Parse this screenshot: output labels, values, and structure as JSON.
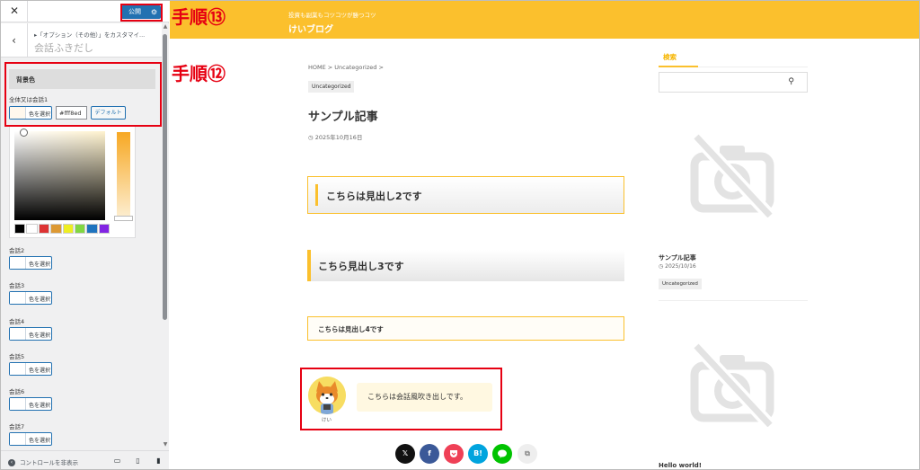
{
  "customizer": {
    "close_glyph": "✕",
    "publish_label": "公開",
    "back_glyph": "‹",
    "breadcrumb": "▸「オプション（その他）」をカスタマイ...",
    "section_title": "会話ふきだし",
    "background_heading": "背景色",
    "fields": [
      {
        "label": "全体又は会話1",
        "button": "色を選択"
      },
      {
        "label": "会話2",
        "button": "色を選択"
      },
      {
        "label": "会話3",
        "button": "色を選択"
      },
      {
        "label": "会話4",
        "button": "色を選択"
      },
      {
        "label": "会話5",
        "button": "色を選択"
      },
      {
        "label": "会話6",
        "button": "色を選択"
      },
      {
        "label": "会話7",
        "button": "色を選択"
      }
    ],
    "hex_value": "#fff8ed",
    "default_label": "デフォルト",
    "palette": [
      "#000000",
      "#ffffff",
      "#dd3333",
      "#dd9933",
      "#eeee22",
      "#81d742",
      "#1e73be",
      "#8224e3"
    ],
    "hide_controls": "コントロールを非表示"
  },
  "annotations": {
    "step13": "手順⑬",
    "step12": "手順⑫"
  },
  "site": {
    "tagline": "投資も副業もコツコツが勝つコツ",
    "name": "けいブログ",
    "breadcrumb": "HOME > Uncategorized >",
    "category": "Uncategorized",
    "post_title": "サンプル記事",
    "post_date": "2025年10月16日",
    "h2": "こちらは見出し2です",
    "h3": "こちら見出し3です",
    "h4": "こちらは見出し4です",
    "speech": "こちらは会話風吹き出しです。",
    "avatar_name": "けい",
    "share": {
      "x": "𝕏",
      "facebook": "f",
      "pocket": "",
      "hatena": "B!",
      "line": ""
    }
  },
  "sidebar": {
    "search_title": "検索",
    "recent_title": "サンプル記事",
    "recent_date": "2025/10/16",
    "recent_tag": "Uncategorized",
    "next_title": "Hello world!"
  },
  "colors": {
    "accent": "#fbc02d",
    "annotation": "#e60012",
    "wp_blue": "#2271b1"
  }
}
